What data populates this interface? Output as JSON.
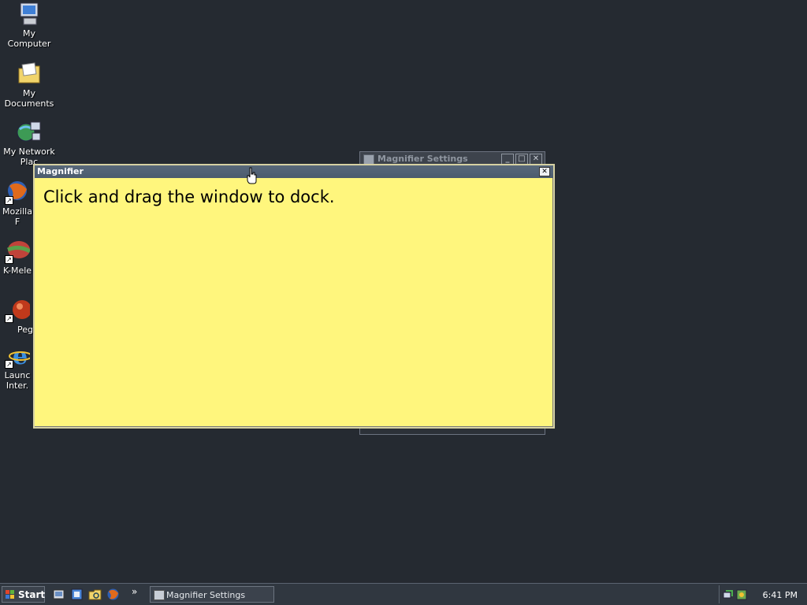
{
  "desktop": {
    "icons": [
      {
        "label": "My Computer"
      },
      {
        "label": "My Documents"
      },
      {
        "label": "My Network\nPlac"
      },
      {
        "label": "Mozilla F"
      },
      {
        "label": "K-Mele"
      },
      {
        "label": "Peg"
      },
      {
        "label": "Launc\nInter."
      }
    ]
  },
  "settings_window": {
    "title": "Magnifier Settings",
    "buttons": [
      "_",
      "□",
      "✕"
    ]
  },
  "magnifier_window": {
    "title": "Magnifier",
    "close": "✕",
    "message": "Click and drag the window to dock."
  },
  "taskbar": {
    "start_label": "Start",
    "chevron": "»",
    "task_button_label": "Magnifier Settings",
    "clock": "6:41 PM"
  },
  "colors": {
    "desktop": "#252a31",
    "magnifier_body": "#fff67d",
    "titlebar": "#58687a"
  }
}
